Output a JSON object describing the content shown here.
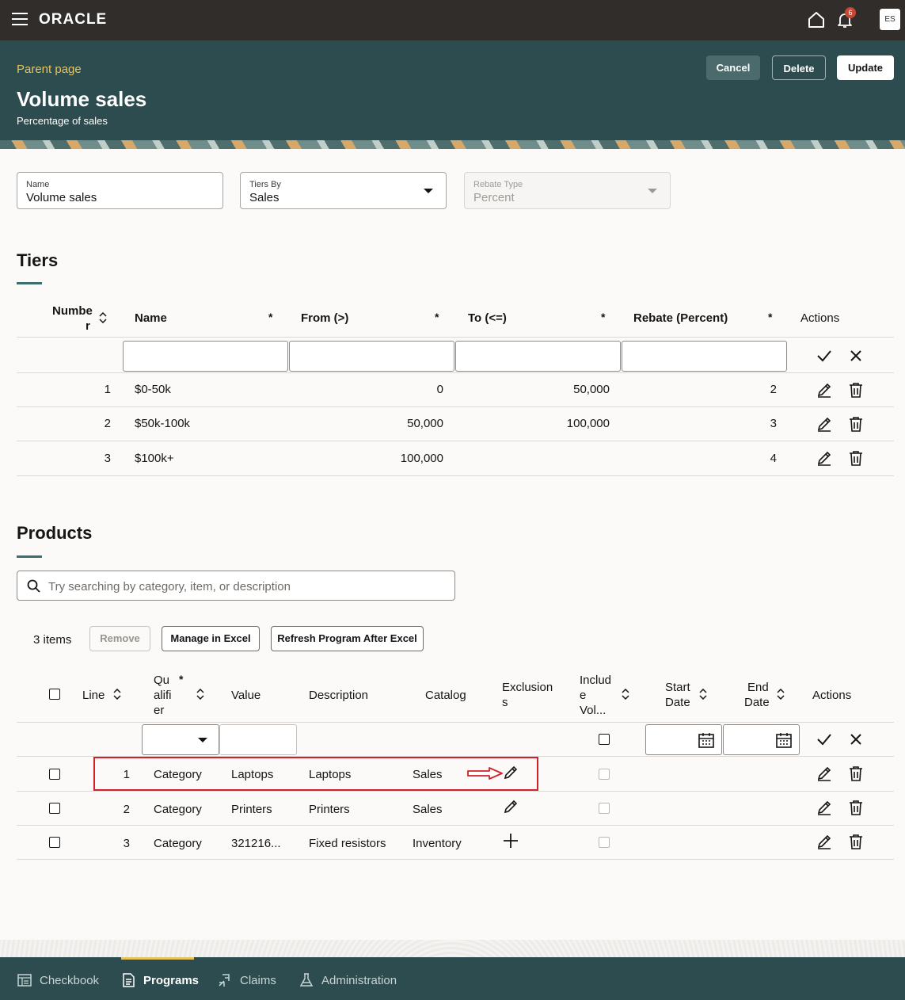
{
  "app": {
    "logo": "ORACLE",
    "notification_count": "6",
    "avatar_initials": "ES"
  },
  "header": {
    "parent_link": "Parent page",
    "title": "Volume sales",
    "subtitle": "Percentage of sales",
    "cancel": "Cancel",
    "delete": "Delete",
    "update": "Update"
  },
  "form": {
    "name": {
      "label": "Name",
      "value": "Volume sales"
    },
    "tiers_by": {
      "label": "Tiers By",
      "value": "Sales"
    },
    "rebate_type": {
      "label": "Rebate Type",
      "value": "Percent"
    }
  },
  "tiers": {
    "title": "Tiers",
    "columns": {
      "number_a": "Numbe",
      "number_b": "r",
      "name": "Name",
      "from": "From (>)",
      "to": "To (<=)",
      "rebate": "Rebate (Percent)",
      "actions": "Actions",
      "required_mark": "*"
    },
    "rows": [
      {
        "number": "1",
        "name": "$0-50k",
        "from": "0",
        "to": "50,000",
        "rebate": "2"
      },
      {
        "number": "2",
        "name": "$50k-100k",
        "from": "50,000",
        "to": "100,000",
        "rebate": "3"
      },
      {
        "number": "3",
        "name": "$100k+",
        "from": "100,000",
        "to": "",
        "rebate": "4"
      }
    ]
  },
  "products": {
    "title": "Products",
    "search_placeholder": "Try searching by category, item, or description",
    "count": "3 items",
    "remove": "Remove",
    "manage_excel": "Manage in Excel",
    "refresh": "Refresh Program After Excel",
    "columns": {
      "line": "Line",
      "qualifier_1": "Qu",
      "qualifier_2": "alifi",
      "qualifier_3": "er",
      "value": "Value",
      "description": "Description",
      "catalog": "Catalog",
      "exclusions_1": "Exclusion",
      "exclusions_2": "s",
      "include_1": "Includ",
      "include_2": "e",
      "include_3": "Vol...",
      "start_1": "Start",
      "start_2": "Date",
      "end_1": "End",
      "end_2": "Date",
      "actions": "Actions",
      "required_mark": "*"
    },
    "rows": [
      {
        "line": "1",
        "qualifier": "Category",
        "value": "Laptops",
        "description": "Laptops",
        "catalog": "Sales",
        "exclusion_icon": "pencil-icon"
      },
      {
        "line": "2",
        "qualifier": "Category",
        "value": "Printers",
        "description": "Printers",
        "catalog": "Sales",
        "exclusion_icon": "pencil-icon"
      },
      {
        "line": "3",
        "qualifier": "Category",
        "value": "321216...",
        "description": "Fixed resistors",
        "catalog": "Inventory",
        "exclusion_icon": "plus-icon"
      }
    ]
  },
  "bottom_nav": [
    {
      "label": "Checkbook",
      "icon": "checkbook-icon"
    },
    {
      "label": "Programs",
      "icon": "document-icon"
    },
    {
      "label": "Claims",
      "icon": "claims-icon"
    },
    {
      "label": "Administration",
      "icon": "flask-icon"
    }
  ],
  "colors": {
    "topbar": "#312d2a",
    "header": "#2d4c4f",
    "accent": "#e8c45c",
    "highlight": "#d22128"
  }
}
